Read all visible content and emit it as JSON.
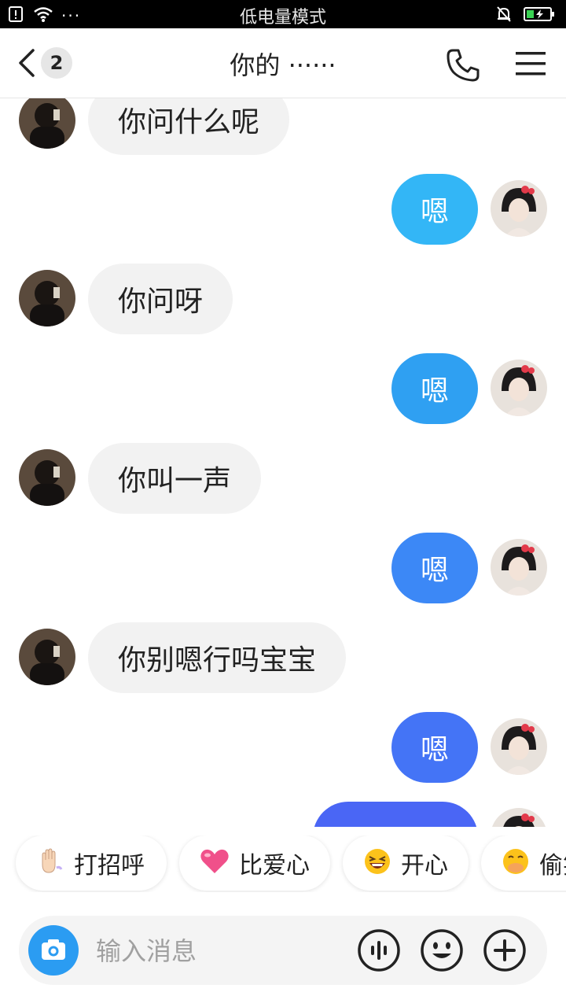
{
  "status_bar": {
    "mode_text": "低电量模式",
    "more": "···"
  },
  "nav": {
    "back_badge": "2",
    "title": "你的 ······"
  },
  "messages": [
    {
      "side": "in",
      "text": "你问什么呢"
    },
    {
      "side": "out",
      "text": "嗯"
    },
    {
      "side": "in",
      "text": "你问呀"
    },
    {
      "side": "out",
      "text": "嗯"
    },
    {
      "side": "in",
      "text": "你叫一声"
    },
    {
      "side": "out",
      "text": "嗯"
    },
    {
      "side": "in",
      "text": "你别嗯行吗宝宝"
    },
    {
      "side": "out",
      "text": "嗯"
    }
  ],
  "quick_replies": [
    {
      "icon": "waving-hand-icon",
      "label": "打招呼"
    },
    {
      "icon": "heart-icon",
      "label": "比爱心"
    },
    {
      "icon": "laughing-face-icon",
      "label": "开心"
    },
    {
      "icon": "peeking-face-icon",
      "label": "偷笑"
    }
  ],
  "input": {
    "placeholder": "输入消息"
  },
  "colors": {
    "outgoing_bubble_1": "#33b6f6",
    "outgoing_bubble_2": "#2fa0f2",
    "outgoing_bubble_3": "#3c88f6",
    "outgoing_bubble_4": "#4474f6",
    "incoming_bubble": "#f2f2f2",
    "camera_button": "#2b9cf2"
  }
}
